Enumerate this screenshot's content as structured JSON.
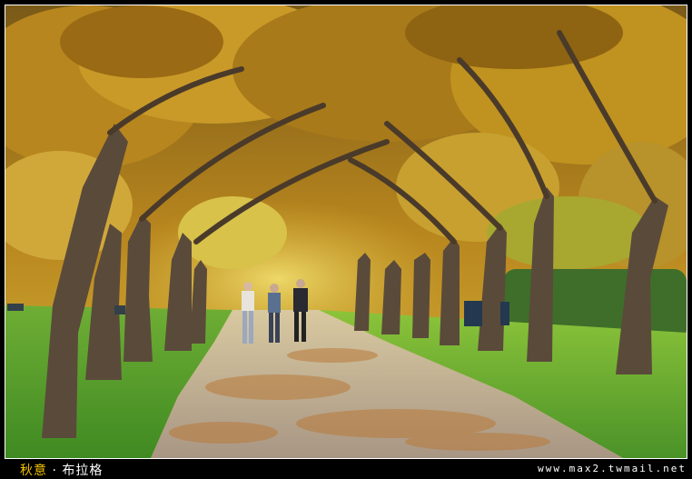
{
  "caption": {
    "title_highlight": "秋意",
    "separator": "·",
    "title_rest": "布拉格",
    "website": "www.max2.twmail.net"
  },
  "colors": {
    "foliage_gold": "#c9a227",
    "foliage_orange": "#b8741a",
    "grass_green": "#4f9a2a",
    "path_tan": "#b09a82",
    "trunk_brown": "#5a4a3a",
    "caption_accent": "#f0c000"
  }
}
